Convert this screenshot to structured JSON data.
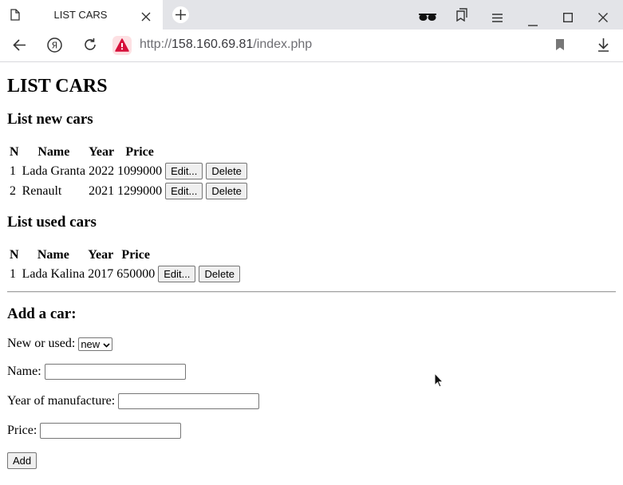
{
  "browser": {
    "tab_title": "LIST CARS",
    "url_scheme": "http://",
    "url_host": "158.160.69.81",
    "url_path": "/index.php"
  },
  "page": {
    "title": "LIST CARS",
    "new_section_title": "List new cars",
    "used_section_title": "List used cars",
    "add_section_title": "Add a car:"
  },
  "tables": {
    "headers": [
      "N",
      "Name",
      "Year",
      "Price"
    ],
    "new_cars": [
      {
        "n": "1",
        "name": "Lada Granta",
        "year": "2022",
        "price": "1099000"
      },
      {
        "n": "2",
        "name": "Renault",
        "year": "2021",
        "price": "1299000"
      }
    ],
    "used_cars": [
      {
        "n": "1",
        "name": "Lada Kalina",
        "year": "2017",
        "price": "650000"
      }
    ],
    "edit_label": "Edit...",
    "delete_label": "Delete"
  },
  "form": {
    "type_label": "New or used:",
    "type_value": "new",
    "name_label": "Name:",
    "name_value": "",
    "year_label": "Year of manufacture:",
    "year_value": "",
    "price_label": "Price:",
    "price_value": "",
    "add_label": "Add"
  },
  "icons": {
    "tab": "page-icon",
    "close": "close-icon",
    "new_tab": "plus-icon",
    "incognito": "glasses-icon",
    "collections": "bookmarks-stack-icon",
    "menu": "hamburger-icon",
    "minimize": "minimize-icon",
    "maximize": "maximize-icon",
    "window_close": "window-close-icon",
    "back": "back-arrow-icon",
    "yandex": "yandex-icon",
    "reload": "reload-icon",
    "security": "warning-triangle-icon",
    "bookmark": "bookmark-icon",
    "download": "download-icon"
  },
  "colors": {
    "tab_bar": "#e3e4e8",
    "security_bg": "#fde0e3",
    "security_icon": "#d6103a"
  }
}
